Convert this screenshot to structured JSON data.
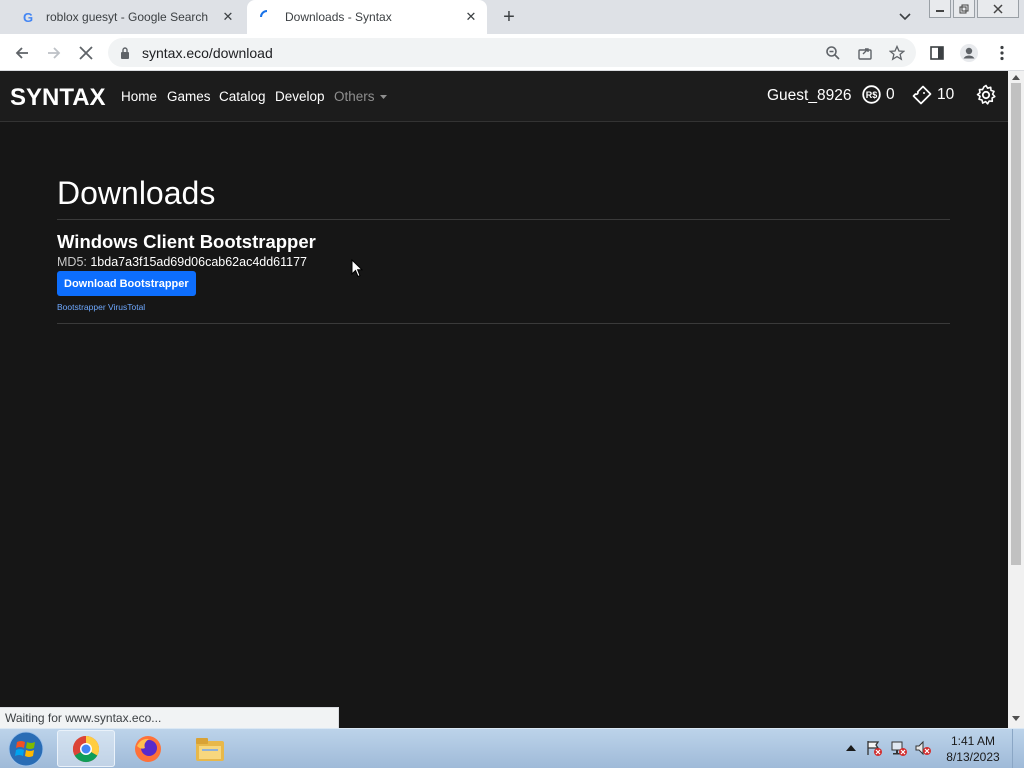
{
  "browser": {
    "tabs": [
      {
        "title": "roblox guesyt - Google Search",
        "favicon": "G"
      },
      {
        "title": "Downloads - Syntax"
      }
    ],
    "url": "syntax.eco/download",
    "status": "Waiting for www.syntax.eco..."
  },
  "nav": {
    "brand": "SYNTAX",
    "links": [
      "Home",
      "Games",
      "Catalog",
      "Develop"
    ],
    "others": "Others",
    "username": "Guest_8926",
    "robux": "0",
    "tickets": "10"
  },
  "page": {
    "title": "Downloads",
    "section_title": "Windows Client Bootstrapper",
    "md5_label": "MD5:",
    "md5_hash": "1bda7a3f15ad69d06cab62ac4dd61177",
    "download_button": "Download Bootstrapper",
    "virustotal_link": "Bootstrapper VirusTotal"
  },
  "taskbar": {
    "time": "1:41 AM",
    "date": "8/13/2023"
  },
  "colors": {
    "page_bg": "#161616",
    "navbar_bg": "#1c1c1c",
    "button_blue": "#0d6efd",
    "link_blue": "#6ea8fe"
  }
}
